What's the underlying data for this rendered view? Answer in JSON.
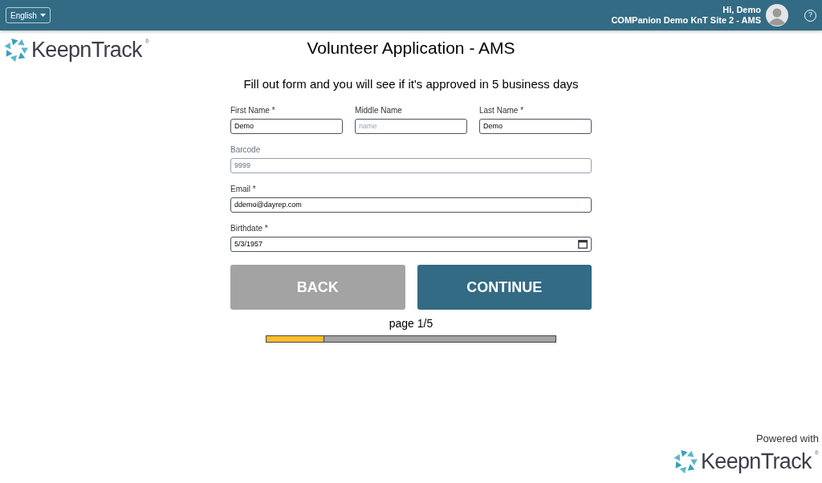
{
  "header": {
    "language": "English",
    "greeting": "Hi, Demo",
    "site": "COMPanion Demo KnT Site 2 - AMS",
    "help": "?"
  },
  "logo": {
    "name": "KeepnTrack",
    "mark": "®"
  },
  "title": "Volunteer Application - AMS",
  "subtitle": "Fill out form and you will see if it's approved in 5 business days",
  "name_fields": [
    {
      "label": "First Name *",
      "value": "Demo",
      "disabled": false
    },
    {
      "label": "Middle Name",
      "placeholder": "name",
      "disabled": false
    },
    {
      "label": "Last Name *",
      "value": "Demo",
      "disabled": false
    }
  ],
  "fields": [
    {
      "label": "Barcode",
      "value": "9999",
      "disabled": true,
      "kind": "text"
    },
    {
      "label": "Email *",
      "value": "ddemo@dayrep.com",
      "disabled": false,
      "kind": "text"
    },
    {
      "label": "Birthdate *",
      "value": "5/3/1957",
      "disabled": false,
      "kind": "date"
    }
  ],
  "buttons": [
    {
      "label": "BACK",
      "kind": "secondary"
    },
    {
      "label": "CONTINUE",
      "kind": "primary"
    }
  ],
  "progress": {
    "label": "page 1/5",
    "level": 0.2
  },
  "footer": {
    "powered": "Powered with",
    "logo": {
      "name": "KeepnTrack",
      "mark": "®"
    }
  }
}
